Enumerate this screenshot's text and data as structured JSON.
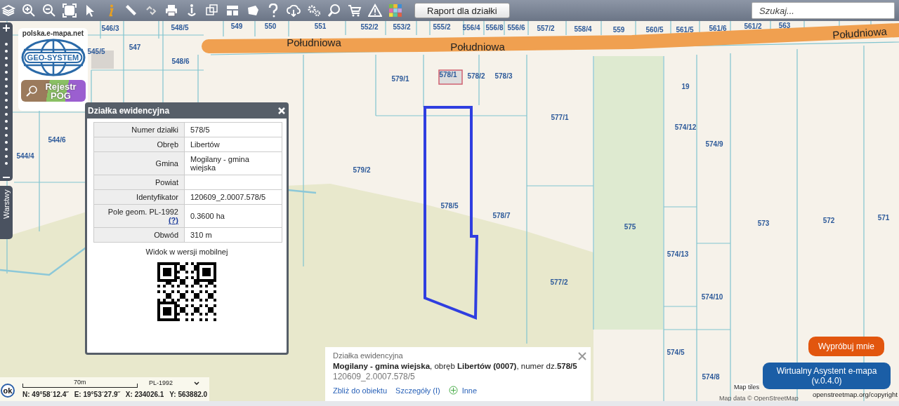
{
  "toolbar": {
    "report_button": "Raport dla działki",
    "search": {
      "placeholder": "Szukaj..."
    }
  },
  "side_panel": {
    "layers_tab": "Warstwy"
  },
  "logo": {
    "site": "polska.e-mapa.net",
    "brand": "GEO-SYSTEM",
    "register_badge": "Rejestr POG"
  },
  "map": {
    "parcel_labels": [
      "546/3",
      "548/5",
      "549",
      "550",
      "551",
      "552/2",
      "553/2",
      "555/2",
      "556/4",
      "556/8",
      "556/6",
      "557/2",
      "558/4",
      "559",
      "560/5",
      "561/5",
      "561/6",
      "561/2",
      "563",
      "545/5",
      "547",
      "548/6",
      "579/1",
      "578/1",
      "578/2",
      "578/3",
      "19",
      "577/1",
      "574/12",
      "574/9",
      "544/6",
      "544/4",
      "579/2",
      "578/5",
      "578/7",
      "575",
      "573",
      "572",
      "571",
      "574/13",
      "574/10",
      "577/2",
      "574/5",
      "574/8"
    ],
    "street_labels": [
      "Południowa",
      "Południowa",
      "Południowa"
    ]
  },
  "popup": {
    "title": "Działka ewidencyjna",
    "rows": [
      {
        "label": "Numer działki",
        "value": "578/5"
      },
      {
        "label": "Obręb",
        "value": "Libertów"
      },
      {
        "label": "Gmina",
        "value": "Mogilany - gmina wiejska"
      },
      {
        "label": "Powiat"
      },
      {
        "label": "Identyfikator",
        "value": "120609_2.0007.578/5"
      },
      {
        "label": "Pole geom. PL-1992",
        "help_link": "(?)",
        "value": "0.3600 ha"
      },
      {
        "label": "Obwód",
        "value": "310 m"
      }
    ],
    "mobile_caption": "Widok w wersji mobilnej"
  },
  "info_panel": {
    "title": "Działka ewidencyjna",
    "description": "**Mogilany - gmina wiejska**, obręb **Libertów (0007)**, numer dz.**578/5**",
    "identifier": "120609_2.0007.578/5",
    "links": [
      "Zbliż do obiektu",
      "Szczegóły (I)"
    ],
    "more_link": "Inne"
  },
  "status_bar": {
    "ok": "ok",
    "scale": "70m",
    "crs": "PL-1992",
    "coordinates": [
      "N: 49°58´12.4˝",
      "E: 19°53´27.9˝",
      "X: 234026.1",
      "Y: 563882.0"
    ]
  },
  "assistant": {
    "hint": "Wypróbuj mnie",
    "button": "Wirtualny Asystent e-mapa (v.0.4.0)"
  },
  "attribution": [
    "Map tiles",
    "Map data © OpenStreetMap",
    "openstreetmap.org/copyright"
  ]
}
